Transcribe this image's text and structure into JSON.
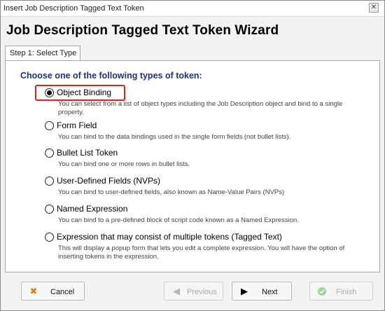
{
  "window": {
    "title": "Insert Job Description Tagged Text Token",
    "close_glyph": "✕"
  },
  "wizard": {
    "title": "Job Description Tagged Text Token Wizard",
    "step_tab": "Step 1: Select Type"
  },
  "panel": {
    "heading": "Choose one of the following types of token:",
    "options": [
      {
        "label": "Object Binding",
        "description": "You can select from a list of object types including the Job Description object and bind to a single property.",
        "selected": true
      },
      {
        "label": "Form Field",
        "description": "You can bind to the data bindings used in the single form fields (not bullet lists).",
        "selected": false
      },
      {
        "label": "Bullet List Token",
        "description": "You can bind one or more rows in bullet lists.",
        "selected": false
      },
      {
        "label": "User-Defined Fields (NVPs)",
        "description": "You can bind to user-defined fields, also known as Name-Value Pairs (NVPs)",
        "selected": false
      },
      {
        "label": "Named Expression",
        "description": "You can bind to a pre-defined block of script code known as a Named Expression.",
        "selected": false
      },
      {
        "label": "Expression that may consist of multiple tokens (Tagged Text)",
        "description": "This will display a popup form that lets you edit a complete expression. You will have the option of inserting tokens in the expression.",
        "selected": false
      }
    ]
  },
  "buttons": {
    "cancel": {
      "label": "Cancel",
      "icon": "x-icon",
      "color": "#e0801a",
      "enabled": true
    },
    "previous": {
      "label": "Previous",
      "icon": "arrow-left-icon",
      "enabled": false
    },
    "next": {
      "label": "Next",
      "icon": "arrow-right-icon",
      "enabled": true
    },
    "finish": {
      "label": "Finish",
      "icon": "check-circle-icon",
      "color": "#9bd69b",
      "enabled": false
    }
  },
  "colors": {
    "heading": "#1c2f8f",
    "highlight": "#e0201a"
  }
}
